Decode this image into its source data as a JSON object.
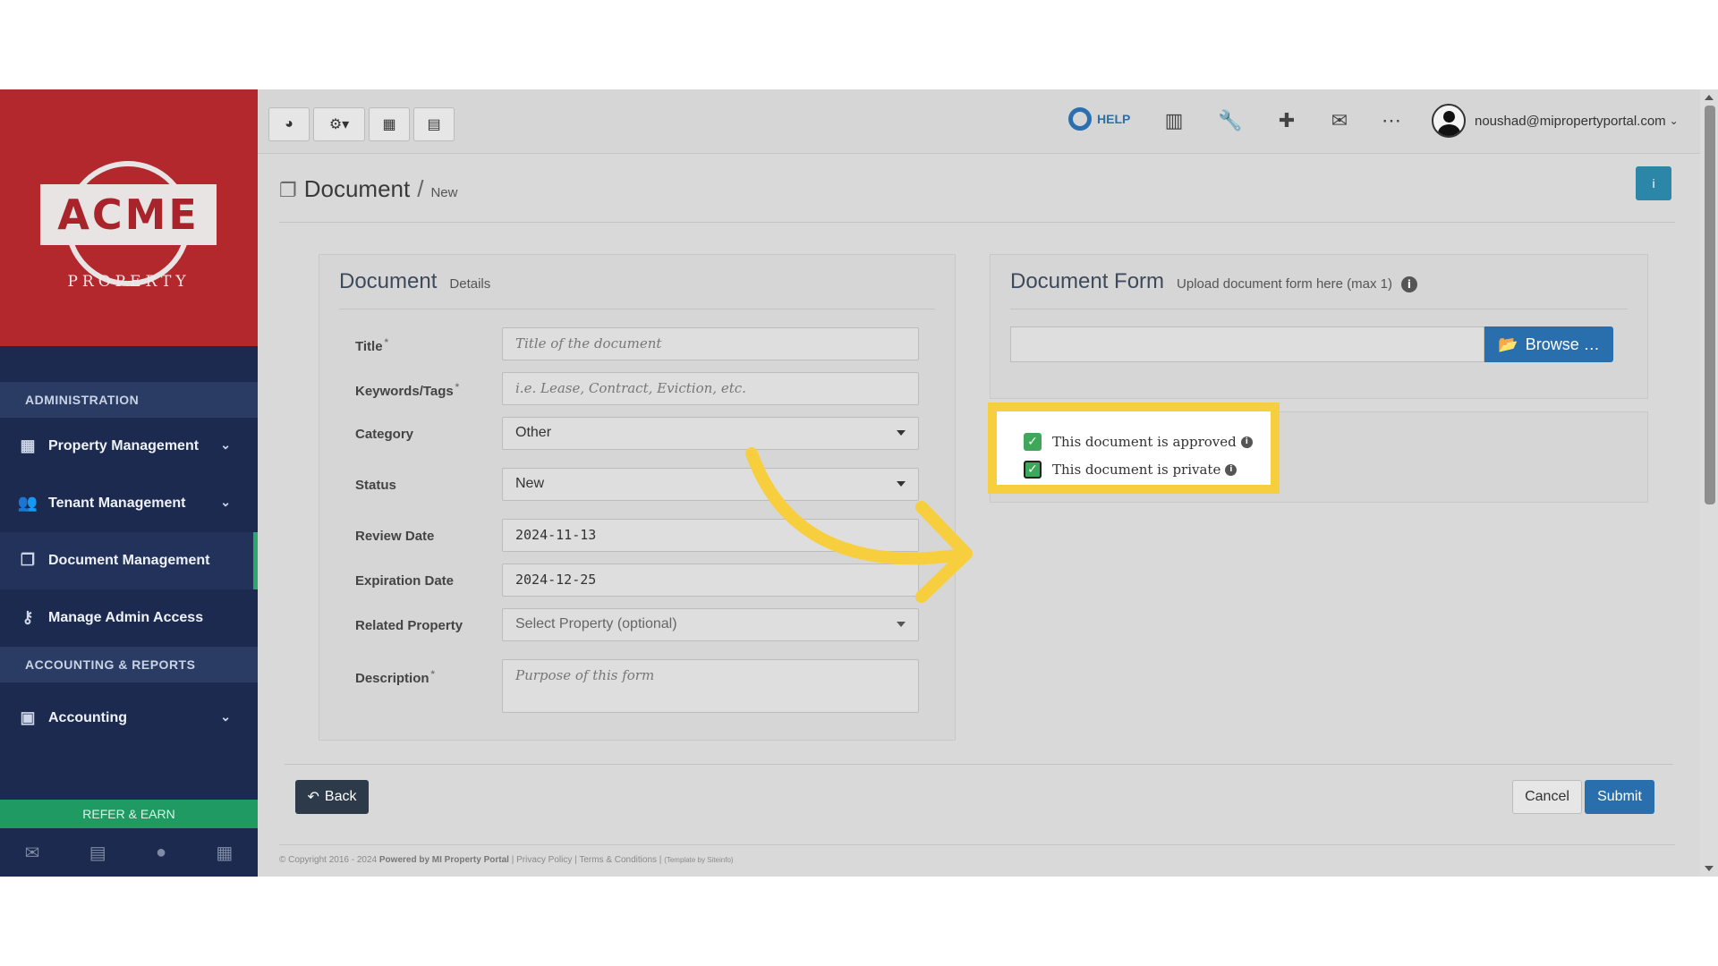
{
  "sidebar": {
    "logo_text": "ACME",
    "logo_sub": "PROPERTY",
    "section_admin": "ADMINISTRATION",
    "items_admin": [
      {
        "label": "Property Management",
        "icon": "building-icon"
      },
      {
        "label": "Tenant Management",
        "icon": "users-icon"
      },
      {
        "label": "Document Management",
        "icon": "documents-icon"
      },
      {
        "label": "Manage Admin Access",
        "icon": "key-icon"
      }
    ],
    "section_accounting": "ACCOUNTING & REPORTS",
    "items_accounting": [
      {
        "label": "Accounting",
        "icon": "money-icon"
      }
    ],
    "refer": "REFER & EARN",
    "footer_icons": [
      "mail-icon",
      "briefcase-icon",
      "user-icon",
      "calculator-icon"
    ]
  },
  "topbar": {
    "left_buttons": [
      "dashboard-icon",
      "settings-icon",
      "calendar-icon",
      "calculator-icon"
    ],
    "help": "HELP",
    "right_icons": [
      "chart-icon",
      "wrench-icon",
      "plus-icon",
      "mail-icon",
      "more-icon"
    ],
    "user_email": "noushad@mipropertyportal.com"
  },
  "page": {
    "title": "Document",
    "separator": "/",
    "crumb": "New"
  },
  "details": {
    "title": "Document",
    "subtitle": "Details",
    "fields": {
      "title_label": "Title",
      "title_placeholder": "Title of the document",
      "keywords_label": "Keywords/Tags",
      "keywords_placeholder": "i.e. Lease, Contract, Eviction, etc.",
      "category_label": "Category",
      "category_value": "Other",
      "status_label": "Status",
      "status_value": "New",
      "review_label": "Review Date",
      "review_value": "2024-11-13",
      "expiration_label": "Expiration Date",
      "expiration_value": "2024-12-25",
      "property_label": "Related Property",
      "property_placeholder": "Select Property (optional)",
      "description_label": "Description",
      "description_placeholder": "Purpose of this form"
    },
    "required_mark": "*"
  },
  "form_panel": {
    "title": "Document Form",
    "subtitle": "Upload document form here (max 1)",
    "browse": "Browse …"
  },
  "checks": {
    "approved": "This document is approved",
    "private": "This document is private"
  },
  "actions": {
    "back": "Back",
    "cancel": "Cancel",
    "submit": "Submit"
  },
  "footer": {
    "copyright": "© Copyright 2016 - 2024",
    "powered": "Powered by MI Property Portal",
    "privacy": "Privacy Policy",
    "terms": "Terms & Conditions",
    "template": "(Template by Siteinfo)"
  },
  "colors": {
    "accent": "#2a6fad",
    "highlight": "#f7cf3e",
    "checkbox": "#3fa75a",
    "sidebar": "#1d2a4f",
    "logo_bg": "#b3282d"
  }
}
